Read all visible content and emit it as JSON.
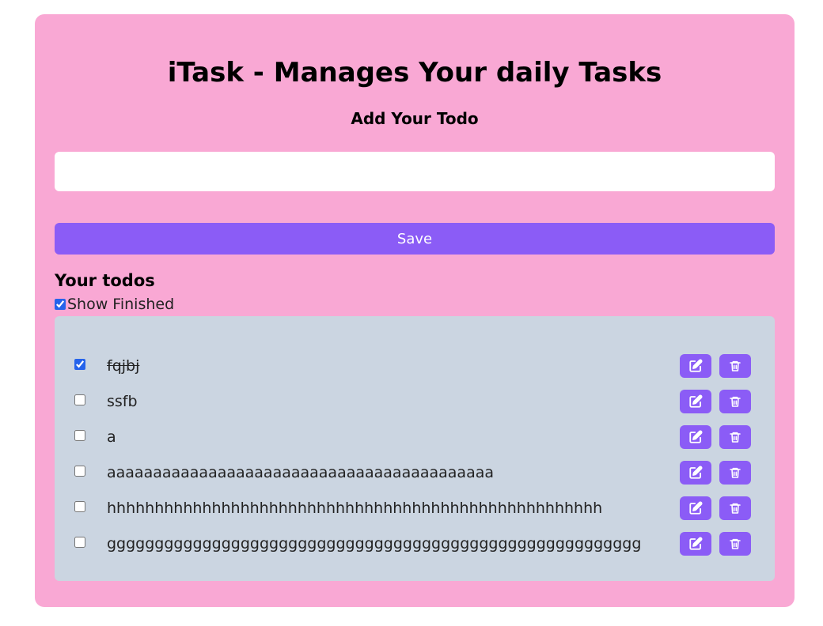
{
  "header": {
    "title": "iTask - Manages Your daily Tasks",
    "subtitle": "Add Your Todo"
  },
  "input": {
    "value": "",
    "placeholder": ""
  },
  "save_label": "Save",
  "todos_section": {
    "title": "Your todos",
    "show_finished_label": "Show Finished",
    "show_finished_checked": true
  },
  "todos": [
    {
      "text": "fqjbj",
      "done": true
    },
    {
      "text": "ssfb",
      "done": false
    },
    {
      "text": "a",
      "done": false
    },
    {
      "text": "aaaaaaaaaaaaaaaaaaaaaaaaaaaaaaaaaaaaaaaaaa",
      "done": false
    },
    {
      "text": "hhhhhhhhhhhhhhhhhhhhhhhhhhhhhhhhhhhhhhhhhhhhhhhhhhhh",
      "done": false
    },
    {
      "text": "gggggggggggggggggggggggggggggggggggggggggggggggggggggggg",
      "done": false
    }
  ],
  "icons": {
    "edit": "edit-icon",
    "delete": "trash-icon"
  },
  "colors": {
    "card_background": "#f9a8d4",
    "accent": "#8b5cf6",
    "list_background": "#cbd5e1"
  }
}
